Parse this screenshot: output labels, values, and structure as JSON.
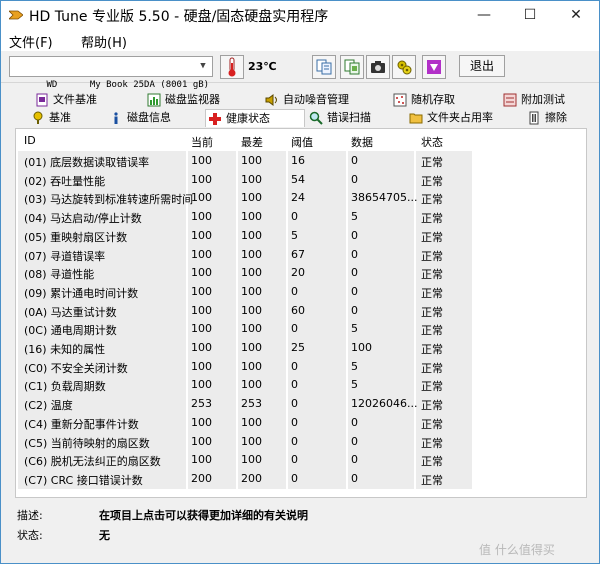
{
  "window": {
    "title": "HD Tune 专业版 5.50 - 硬盘/固态硬盘实用程序",
    "controls": {
      "minimize": "—",
      "maximize": "☐",
      "close": "✕"
    }
  },
  "menu": {
    "file": "文件(F)",
    "help": "帮助(H)"
  },
  "toolbar": {
    "drive": "WD      My Book 25DA (8001 gB)",
    "temperature": "23℃",
    "exit_label": "退出",
    "icons": [
      "copy-text-icon",
      "copy-screenshot-icon",
      "camera-icon",
      "settings-icon",
      "save-icon"
    ]
  },
  "tabs": {
    "row1": [
      {
        "label": "文件基准",
        "icon": "file-benchmark-icon"
      },
      {
        "label": "磁盘监视器",
        "icon": "disk-monitor-icon"
      },
      {
        "label": "自动噪音管理",
        "icon": "speaker-icon"
      },
      {
        "label": "随机存取",
        "icon": "random-access-icon"
      },
      {
        "label": "附加测试",
        "icon": "extra-tests-icon"
      }
    ],
    "row2": [
      {
        "label": "基准",
        "icon": "benchmark-icon"
      },
      {
        "label": "磁盘信息",
        "icon": "info-icon"
      },
      {
        "label": "健康状态",
        "icon": "health-cross-icon",
        "active": true
      },
      {
        "label": "错误扫描",
        "icon": "magnifier-icon"
      },
      {
        "label": "文件夹占用率",
        "icon": "folder-icon"
      },
      {
        "label": "擦除",
        "icon": "erase-icon"
      }
    ]
  },
  "table": {
    "headers": [
      "ID",
      "当前",
      "最差",
      "阈值",
      "数据",
      "状态"
    ],
    "rows": [
      [
        "(01) 底层数据读取错误率",
        "100",
        "100",
        "16",
        "0",
        "正常"
      ],
      [
        "(02) 吞吐量性能",
        "100",
        "100",
        "54",
        "0",
        "正常"
      ],
      [
        "(03) 马达旋转到标准转速所需时间",
        "100",
        "100",
        "24",
        "38654705...",
        "正常"
      ],
      [
        "(04) 马达启动/停止计数",
        "100",
        "100",
        "0",
        "5",
        "正常"
      ],
      [
        "(05) 重映射扇区计数",
        "100",
        "100",
        "5",
        "0",
        "正常"
      ],
      [
        "(07) 寻道错误率",
        "100",
        "100",
        "67",
        "0",
        "正常"
      ],
      [
        "(08) 寻道性能",
        "100",
        "100",
        "20",
        "0",
        "正常"
      ],
      [
        "(09) 累计通电时间计数",
        "100",
        "100",
        "0",
        "0",
        "正常"
      ],
      [
        "(0A) 马达重试计数",
        "100",
        "100",
        "60",
        "0",
        "正常"
      ],
      [
        "(0C) 通电周期计数",
        "100",
        "100",
        "0",
        "5",
        "正常"
      ],
      [
        "(16) 未知的属性",
        "100",
        "100",
        "25",
        "100",
        "正常"
      ],
      [
        "(C0) 不安全关闭计数",
        "100",
        "100",
        "0",
        "5",
        "正常"
      ],
      [
        "(C1) 负载周期数",
        "100",
        "100",
        "0",
        "5",
        "正常"
      ],
      [
        "(C2) 温度",
        "253",
        "253",
        "0",
        "12026046...",
        "正常"
      ],
      [
        "(C4) 重新分配事件计数",
        "100",
        "100",
        "0",
        "0",
        "正常"
      ],
      [
        "(C5) 当前待映射的扇区数",
        "100",
        "100",
        "0",
        "0",
        "正常"
      ],
      [
        "(C6) 脱机无法纠正的扇区数",
        "100",
        "100",
        "0",
        "0",
        "正常"
      ],
      [
        "(C7) CRC 接口错误计数",
        "200",
        "200",
        "0",
        "0",
        "正常"
      ]
    ]
  },
  "details": {
    "description_label": "描述:",
    "description_value": "在项目上点击可以获得更加详细的有关说明",
    "status_label": "状态:",
    "status_value": "无"
  },
  "watermark": "值 什么值得买"
}
